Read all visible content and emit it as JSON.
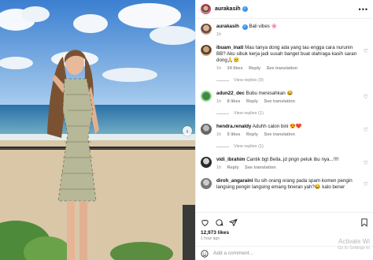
{
  "post": {
    "username": "aurakasih",
    "caption": "Bali vibes",
    "caption_emoji": "🌸",
    "caption_time": "1h",
    "more_icon": "more-horizontal-icon"
  },
  "comments": [
    {
      "username": "ibuam_inati",
      "text": "Mau tanya dong ada yang tau engga cara nurunin BB? Aku sibuk kerja jadi susah banget buat olahraga kasih saran dong🙏😢",
      "time": "1h",
      "likes": "24 likes",
      "reply": "Reply",
      "translation": "See translation",
      "view_replies": "View replies (9)"
    },
    {
      "username": "adun22_dec",
      "text": "Bubu meresahkan 😂",
      "time": "1h",
      "likes": "8 likes",
      "reply": "Reply",
      "translation": "See translation",
      "view_replies": "View replies (1)"
    },
    {
      "username": "hendra.renaldy",
      "text": "Aduhh calon bini 😍❤️",
      "time": "1h",
      "likes": "5 likes",
      "reply": "Reply",
      "translation": "See translation",
      "view_replies": "View replies (1)"
    },
    {
      "username": "vidi_ibrahim",
      "text": "Cantik bgt Bella..jd pngn peluk ibu nya...!!!!",
      "time": "1h",
      "likes": "",
      "reply": "Reply",
      "translation": "See translation",
      "view_replies": ""
    },
    {
      "username": "diroh_angaraini",
      "text": "Itu sih orang orang pada spam komen pengin langsing pengin langsing emang bneran yah?😂 kalo bener",
      "time": "",
      "likes": "",
      "reply": "",
      "translation": "",
      "view_replies": ""
    }
  ],
  "actions": {
    "like_icon": "heart-icon",
    "comment_icon": "comment-icon",
    "share_icon": "send-icon",
    "save_icon": "bookmark-icon",
    "likes_count": "12,973 likes",
    "date": "1 hour ago"
  },
  "add_comment": {
    "placeholder": "Add a comment...",
    "emoji_icon": "smiley-icon"
  },
  "watermark": {
    "line1": "Activate Wi",
    "line2": "Go to Settings to"
  },
  "colors": {
    "link": "#00376b",
    "muted": "#8e8e8e",
    "verified": "#3897f0",
    "story_ring": "#e1306c"
  }
}
